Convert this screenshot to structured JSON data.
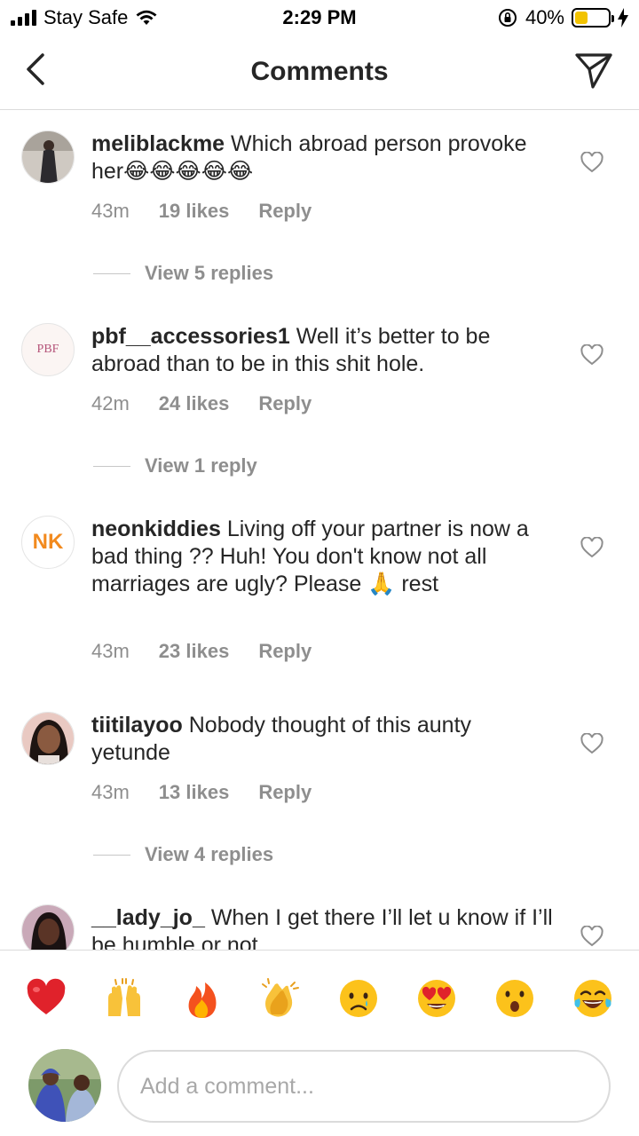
{
  "status_bar": {
    "carrier": "Stay Safe",
    "time": "2:29 PM",
    "battery_percent": "40%",
    "battery_level": 0.4
  },
  "header": {
    "title": "Comments"
  },
  "comments": [
    {
      "username": "meliblackme",
      "text": "Which abroad person provoke her😂😂😂😂😂",
      "time": "43m",
      "likes": "19 likes",
      "reply": "Reply",
      "view_replies": "View 5 replies"
    },
    {
      "username": "pbf__accessories1",
      "text": "Well it’s better to be abroad than to be in this shit hole.",
      "time": "42m",
      "likes": "24 likes",
      "reply": "Reply",
      "view_replies": "View 1 reply",
      "avatar_text": "PBF"
    },
    {
      "username": "neonkiddies",
      "text": "Living off your partner is now a bad thing ?? Huh! You don't know not all marriages are ugly? Please 🙏 rest",
      "time": "43m",
      "likes": "23 likes",
      "reply": "Reply",
      "avatar_text": "NK"
    },
    {
      "username": "tiitilayoo",
      "text": "Nobody thought of this aunty yetunde",
      "time": "43m",
      "likes": "13 likes",
      "reply": "Reply",
      "view_replies": "View 4 replies"
    },
    {
      "username": "__lady_jo_",
      "text": "When I get there I’ll let u know if I’ll be humble or not"
    }
  ],
  "emoji_bar": [
    "❤️",
    "🙌",
    "🔥",
    "👏",
    "😢",
    "😍",
    "😮",
    "😂"
  ],
  "composer": {
    "placeholder": "Add a comment..."
  },
  "colors": {
    "text": "#262626",
    "secondary": "#8e8e8e",
    "divider": "#dbdbdb",
    "battery": "#f2c300"
  }
}
